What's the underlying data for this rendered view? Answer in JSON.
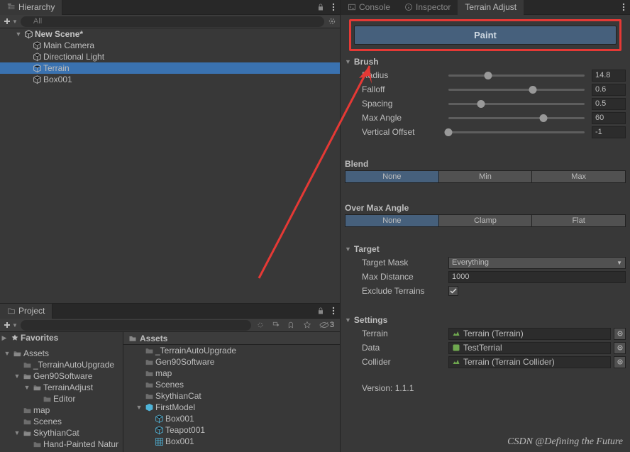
{
  "hierarchy": {
    "tab": "Hierarchy",
    "search_placeholder": "All",
    "scene": "New Scene*",
    "items": [
      "Main Camera",
      "Directional Light",
      "Terrain",
      "Box001"
    ],
    "selected": "Terrain"
  },
  "project": {
    "tab": "Project",
    "search_placeholder": "",
    "hidden_count": "3",
    "favorites": "Favorites",
    "left_tree": [
      {
        "label": "Assets",
        "depth": 0,
        "fold": "▼",
        "type": "folder-open"
      },
      {
        "label": "_TerrainAutoUpgrade",
        "depth": 1,
        "fold": "",
        "type": "folder"
      },
      {
        "label": "Gen90Software",
        "depth": 1,
        "fold": "▼",
        "type": "folder-open"
      },
      {
        "label": "TerrainAdjust",
        "depth": 2,
        "fold": "▼",
        "type": "folder-open"
      },
      {
        "label": "Editor",
        "depth": 3,
        "fold": "",
        "type": "folder"
      },
      {
        "label": "map",
        "depth": 1,
        "fold": "",
        "type": "folder"
      },
      {
        "label": "Scenes",
        "depth": 1,
        "fold": "",
        "type": "folder"
      },
      {
        "label": "SkythianCat",
        "depth": 1,
        "fold": "▼",
        "type": "folder-open"
      },
      {
        "label": "Hand-Painted Natur",
        "depth": 2,
        "fold": "",
        "type": "folder"
      }
    ],
    "crumb": "Assets",
    "right_tree": [
      {
        "label": "_TerrainAutoUpgrade",
        "depth": 0,
        "fold": "",
        "type": "folder"
      },
      {
        "label": "Gen90Software",
        "depth": 0,
        "fold": "",
        "type": "folder"
      },
      {
        "label": "map",
        "depth": 0,
        "fold": "",
        "type": "folder"
      },
      {
        "label": "Scenes",
        "depth": 0,
        "fold": "",
        "type": "folder"
      },
      {
        "label": "SkythianCat",
        "depth": 0,
        "fold": "",
        "type": "folder"
      },
      {
        "label": "FirstModel",
        "depth": 0,
        "fold": "▼",
        "type": "prefab"
      },
      {
        "label": "Box001",
        "depth": 1,
        "fold": "",
        "type": "mesh"
      },
      {
        "label": "Teapot001",
        "depth": 1,
        "fold": "",
        "type": "mesh"
      },
      {
        "label": "Box001",
        "depth": 1,
        "fold": "",
        "type": "grid"
      }
    ]
  },
  "right_tabs": {
    "console": "Console",
    "inspector": "Inspector",
    "terrain_adjust": "Terrain Adjust"
  },
  "paint_button": "Paint",
  "brush": {
    "title": "Brush",
    "rows": [
      {
        "label": "Radius",
        "value": "14.8",
        "pos": 29
      },
      {
        "label": "Falloff",
        "value": "0.6",
        "pos": 62
      },
      {
        "label": "Spacing",
        "value": "0.5",
        "pos": 24
      },
      {
        "label": "Max Angle",
        "value": "60",
        "pos": 70
      },
      {
        "label": "Vertical Offset",
        "value": "-1",
        "pos": 0
      }
    ]
  },
  "blend": {
    "title": "Blend",
    "options": [
      "None",
      "Min",
      "Max"
    ],
    "selected": "None"
  },
  "overmax": {
    "title": "Over Max Angle",
    "options": [
      "None",
      "Clamp",
      "Flat"
    ],
    "selected": "None"
  },
  "target": {
    "title": "Target",
    "mask_label": "Target Mask",
    "mask_value": "Everything",
    "dist_label": "Max Distance",
    "dist_value": "1000",
    "exclude_label": "Exclude Terrains",
    "exclude_checked": true
  },
  "settings": {
    "title": "Settings",
    "terrain_label": "Terrain",
    "terrain_value": "Terrain (Terrain)",
    "data_label": "Data",
    "data_value": "TestTerrial",
    "collider_label": "Collider",
    "collider_value": "Terrain (Terrain Collider)"
  },
  "version": "Version: 1.1.1",
  "watermark": "CSDN @Defining the Future"
}
